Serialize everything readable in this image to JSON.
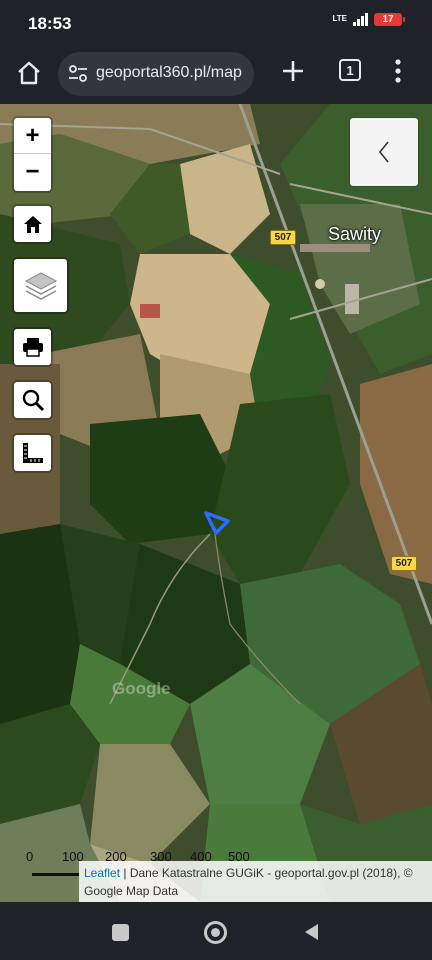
{
  "status": {
    "time": "18:53",
    "network": "LTE",
    "battery": "17"
  },
  "browser": {
    "url": "geoportal360.pl/map",
    "tab_count": "1",
    "icons": [
      "home-icon",
      "site-settings-icon",
      "new-tab-icon",
      "tabs-icon",
      "overflow-menu-icon"
    ]
  },
  "map": {
    "zoom_in_label": "+",
    "zoom_out_label": "−",
    "controls": [
      "home-icon",
      "layers-icon",
      "print-icon",
      "search-icon",
      "measure-icon"
    ],
    "panel_toggle_label": "‹",
    "place_name": "Sawity",
    "road_number": "507",
    "watermark": "Google",
    "scale_labels": [
      "0",
      "100",
      "200",
      "300",
      "400",
      "500"
    ],
    "attribution": {
      "link": "Leaflet",
      "text": " | Dane Katastralne GUGiK - geoportal.gov.pl (2018), © Google Map Data"
    },
    "marker_color": "#2f6bff"
  },
  "navigation": {
    "icons": [
      "recents-icon",
      "home-button-icon",
      "back-icon"
    ]
  }
}
